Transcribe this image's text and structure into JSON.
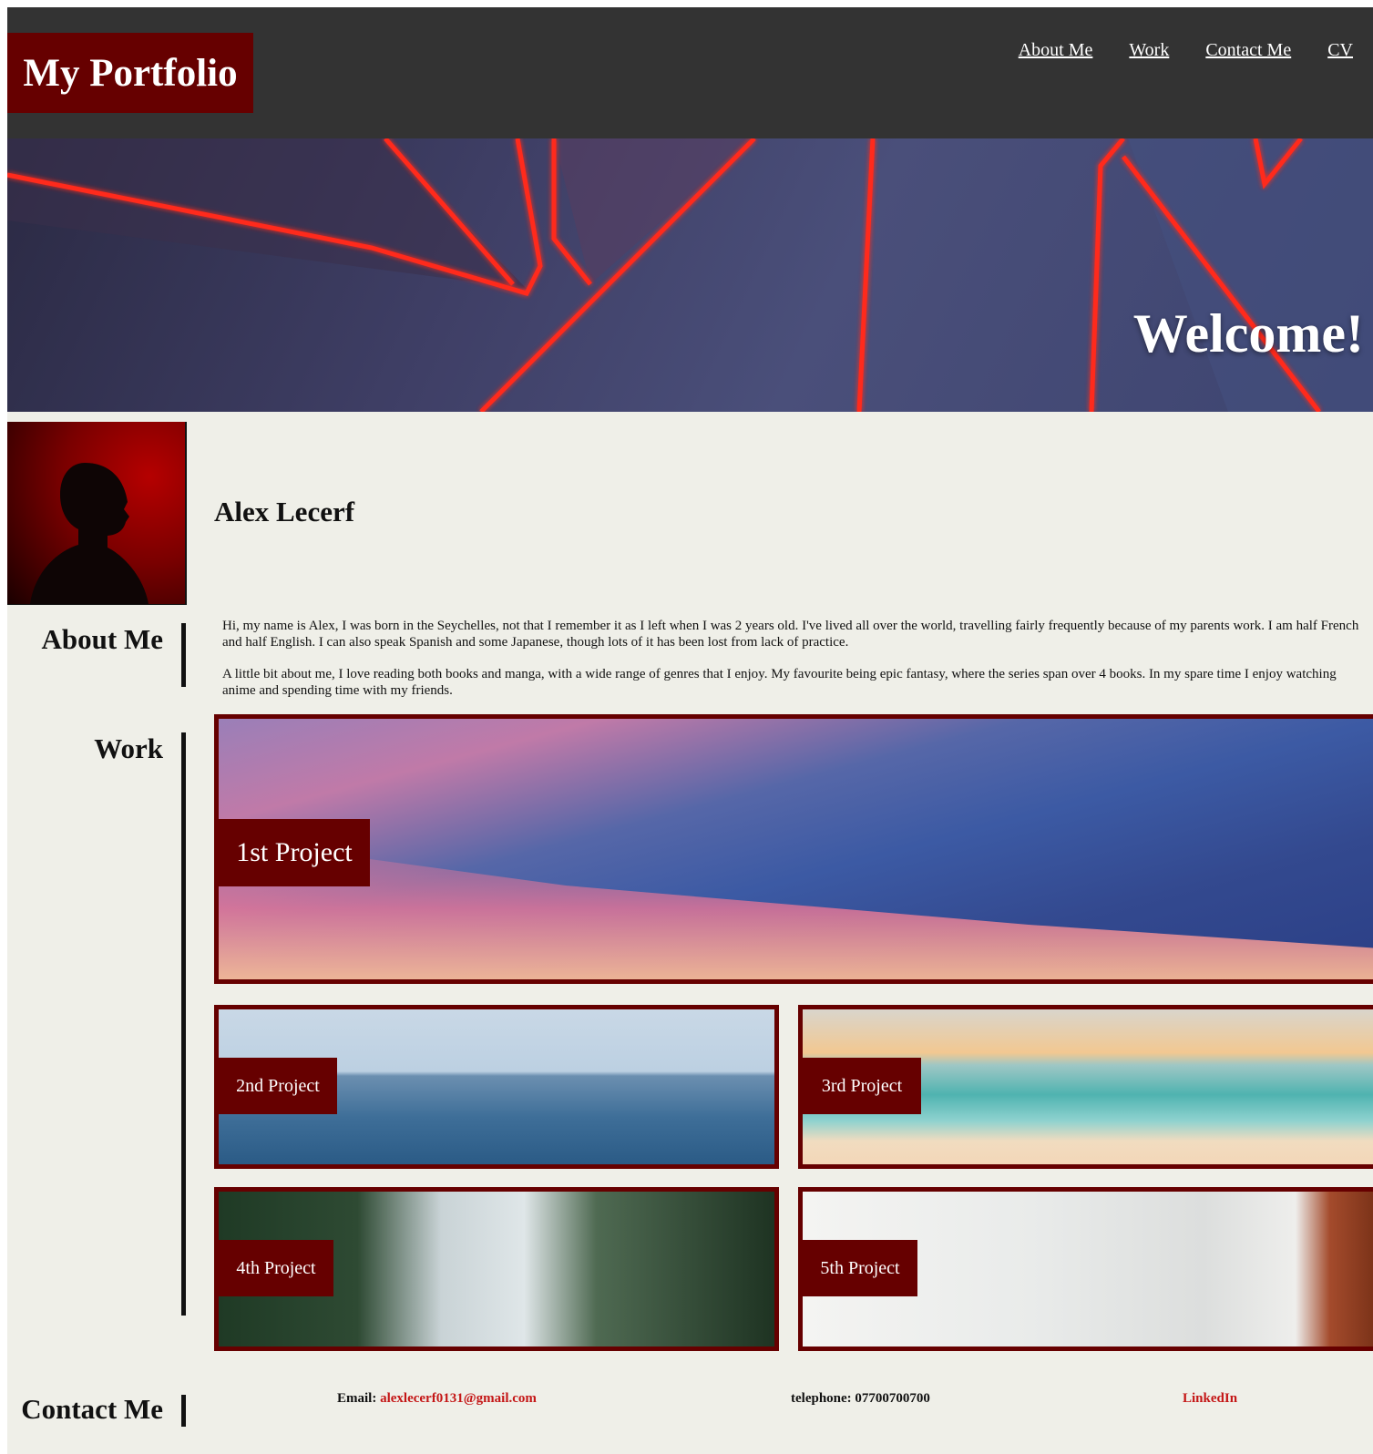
{
  "header": {
    "brand": "My Portfolio",
    "nav": [
      "About Me",
      "Work",
      "Contact Me",
      "CV"
    ]
  },
  "hero": {
    "welcome": "Welcome!"
  },
  "profile": {
    "name": "Alex Lecerf"
  },
  "about": {
    "label": "About Me",
    "paragraphs": [
      "Hi, my name is Alex, I was born in the Seychelles, not that I remember it as I left when I was 2 years old. I've lived all over the world, travelling fairly frequently because of my parents work. I am half French and half English. I can also speak Spanish and some Japanese, though lots of it has been lost from lack of practice.",
      "A little bit about me, I love reading both books and manga, with a wide range of genres that I enjoy. My favourite being epic fantasy, where the series span over 4 books. In my spare time I enjoy watching anime and spending time with my friends."
    ]
  },
  "work": {
    "label": "Work",
    "projects": [
      "1st Project",
      "2nd Project",
      "3rd Project",
      "4th Project",
      "5th Project"
    ]
  },
  "contact": {
    "label": "Contact Me",
    "email_label": "Email:",
    "email": "alexlecerf0131@gmail.com",
    "telephone_label": "telephone:",
    "telephone": "07700700700",
    "linkedin": "LinkedIn"
  },
  "colors": {
    "header_bg": "#333333",
    "accent": "#660000",
    "page_bg": "#efefe8",
    "link": "#c41616"
  }
}
